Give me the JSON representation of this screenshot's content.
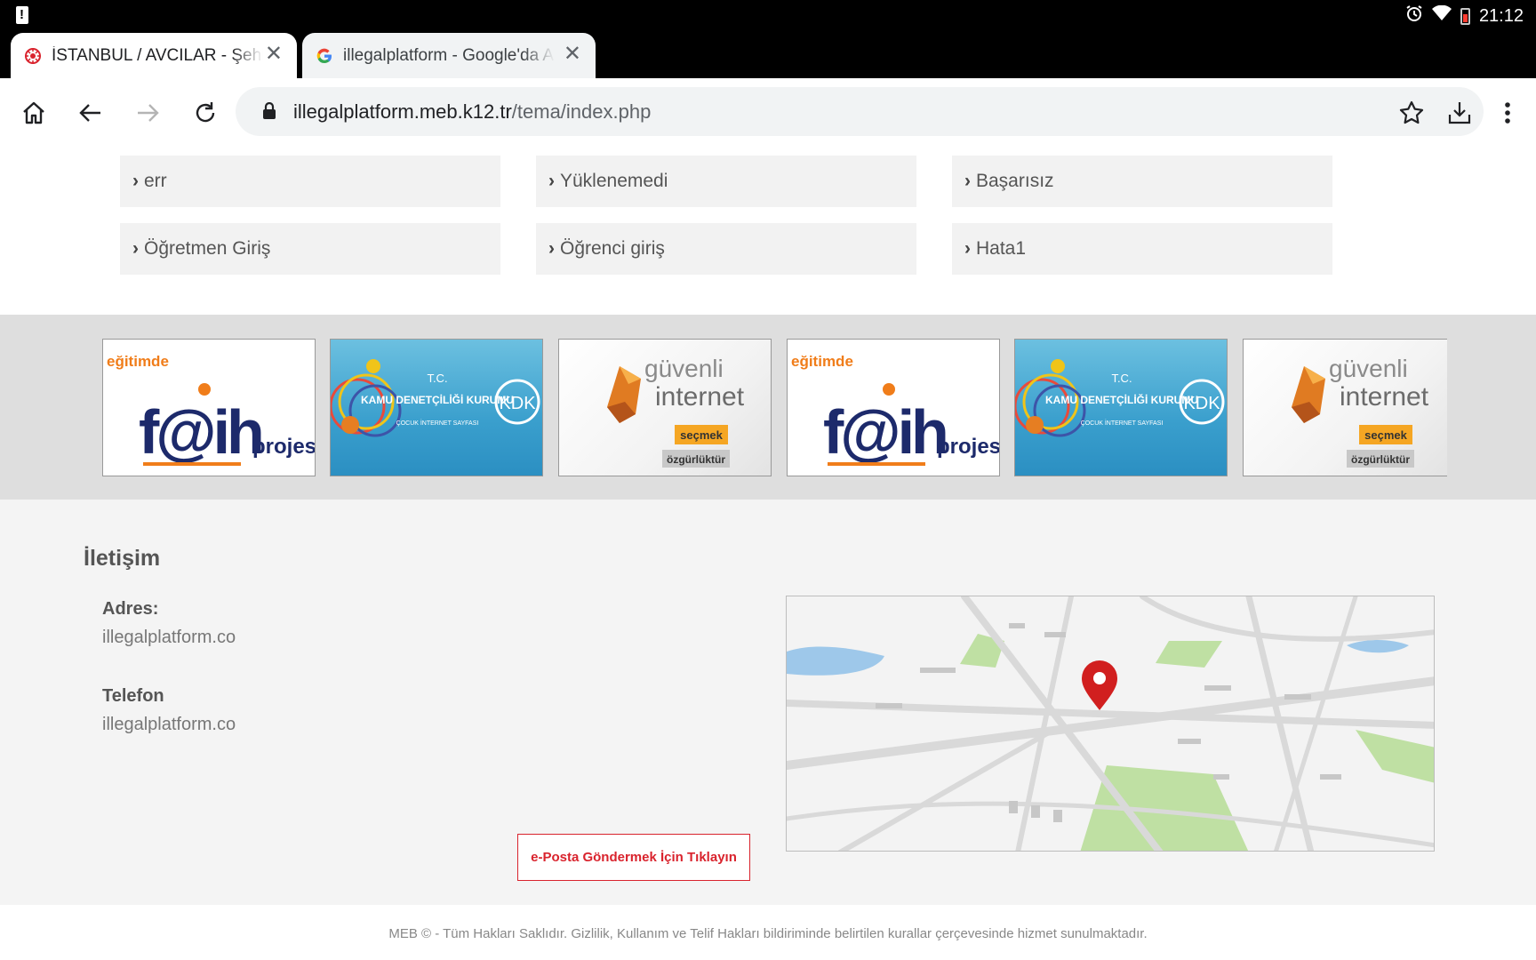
{
  "status_bar": {
    "time": "21:12"
  },
  "tabs": [
    {
      "title": "İSTANBUL / AVCILAR - Şehit",
      "active": true
    },
    {
      "title": "illegalplatform - Google'da Ara",
      "active": false
    }
  ],
  "address_bar": {
    "domain": "illegalplatform.meb.k12.tr",
    "path": "/tema/index.php"
  },
  "quick_links": [
    {
      "label": "err"
    },
    {
      "label": "Yüklenemedi"
    },
    {
      "label": "Başarısız"
    },
    {
      "label": "Öğretmen Giriş"
    },
    {
      "label": "Öğrenci giriş"
    },
    {
      "label": "Hata1"
    }
  ],
  "banners": [
    {
      "kind": "fatih",
      "top": "eğitimde",
      "main": "f@ih",
      "sub": "projesi"
    },
    {
      "kind": "kdk",
      "line1": "T.C.",
      "line2": "KAMU DENETÇİLİĞİ KURUMU",
      "line3": "ÇOCUK İNTERNET SAYFASI",
      "logo": "KDK"
    },
    {
      "kind": "guvenli",
      "line1": "güvenli",
      "line2": "internet",
      "line3": "seçmek",
      "line4": "özgürlüktür"
    },
    {
      "kind": "fatih",
      "top": "eğitimde",
      "main": "f@ih",
      "sub": "projesi"
    },
    {
      "kind": "kdk",
      "line1": "T.C.",
      "line2": "KAMU DENETÇİLİĞİ KURUMU",
      "line3": "ÇOCUK İNTERNET SAYFASI",
      "logo": "KDK"
    },
    {
      "kind": "guvenli",
      "line1": "güvenli",
      "line2": "internet",
      "line3": "seçmek",
      "line4": "özgürlüktür"
    }
  ],
  "contact": {
    "heading": "İletişim",
    "address_label": "Adres:",
    "address_value": "illegalplatform.co",
    "phone_label": "Telefon",
    "phone_value": "illegalplatform.co",
    "email_button": "e-Posta Göndermek İçin Tıklayın"
  },
  "footer": {
    "text": "MEB © - Tüm Hakları Saklıdır. Gizlilik, Kullanım ve Telif Hakları bildiriminde belirtilen kurallar çerçevesinde hizmet sunulmaktadır."
  },
  "colors": {
    "accent_red": "#d9232d",
    "fatih_orange": "#f07d1a",
    "fatih_navy": "#1d2a6b",
    "map_marker": "#d11f1f"
  }
}
